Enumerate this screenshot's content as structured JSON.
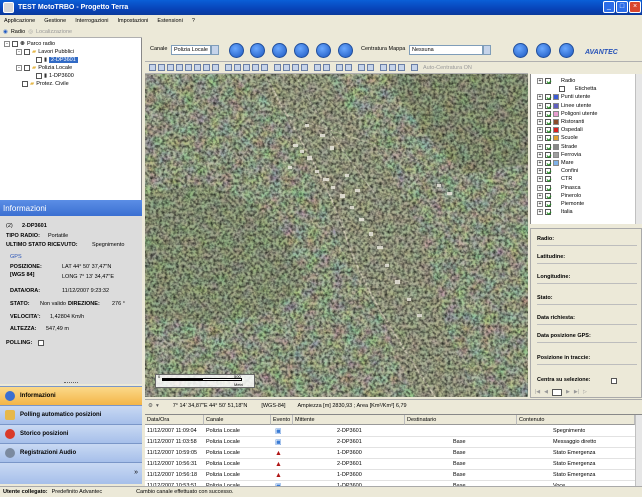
{
  "window": {
    "title": "TEST MotoTRBO - Progetto Terra"
  },
  "menu": [
    "Applicazione",
    "Gestione",
    "Interrogazioni",
    "Impostazioni",
    "Estensioni",
    "?"
  ],
  "left_toolbar": {
    "tab1": "Radio",
    "tab2": "Localizzazione"
  },
  "tree": {
    "root": "Parco radio",
    "groups": [
      {
        "label": "Lavori Pubblici",
        "children": [
          "2-DP3601"
        ]
      },
      {
        "label": "Polizia Locale",
        "children": [
          "1-DP3600"
        ]
      },
      {
        "label": "Protez. Civile",
        "children": []
      }
    ]
  },
  "info": {
    "header": "Informazioni",
    "id_prefix": "(2)",
    "radio_name": "2-DP3601",
    "tipo_label": "TIPO RADIO:",
    "tipo_value": "Portatile",
    "stato_ric_label": "ULTIMO STATO RICEVUTO:",
    "stato_ric_value": "Spegnimento",
    "gps_label": "GPS",
    "pos_label": "POSIZIONE:",
    "wgs_label": "[WGS 84]",
    "lat": "LAT 44° 50' 37,47\"N",
    "long": "LONG 7° 13' 34,47\"E",
    "dataora_label": "DATA/ORA:",
    "dataora_value": "11/12/2007 9:23:32",
    "stato_label": "STATO:",
    "stato_value": "Non valido",
    "dir_label": "DIREZIONE:",
    "dir_value": "276 °",
    "vel_label": "VELOCITA':",
    "vel_value": "1,42804 Km/h",
    "alt_label": "ALTEZZA:",
    "alt_value": "547,49 m",
    "polling_label": "POLLING:"
  },
  "nav": [
    "Informazioni",
    "Polling automatico posizioni",
    "Storico posizioni",
    "Registrazioni Audio"
  ],
  "map_toolbar": {
    "canale_label": "Canale",
    "canale_value": "Polizia Locale",
    "centratura_label": "Centratura Mappa",
    "centratura_value": "Nessuna",
    "auto_label": "Auto-Centratura ON",
    "brand": "AVANTEC"
  },
  "scale": {
    "zero": "0",
    "end": "500",
    "unit": "Metri"
  },
  "coords": {
    "position": "7° 14' 34,87\"E  44° 50' 51,18\"N",
    "crs": "[WGS-84]",
    "ampiezza": "Ampiezza [m] 2830,93 ; Area [Km²/Km²] 6,79"
  },
  "layers": [
    {
      "label": "Radio",
      "checked": true,
      "color": ""
    },
    {
      "label": "Etichetta",
      "checked": false,
      "color": ""
    },
    {
      "label": "Punti utente",
      "checked": true,
      "color": "#3b5bd6"
    },
    {
      "label": "Linee utente",
      "checked": true,
      "color": "#6060c0"
    },
    {
      "label": "Poligoni utente",
      "checked": true,
      "color": "#e89fd0"
    },
    {
      "label": "Ristoranti",
      "checked": true,
      "color": "#8b4b2b"
    },
    {
      "label": "Ospedali",
      "checked": true,
      "color": "#d92020"
    },
    {
      "label": "Scuole",
      "checked": true,
      "color": "#e0a030"
    },
    {
      "label": "Strade",
      "checked": true,
      "color": "#888888"
    },
    {
      "label": "Ferrovia",
      "checked": true,
      "color": "#a0a0a0"
    },
    {
      "label": "Mare",
      "checked": true,
      "color": "#7fb2e8"
    },
    {
      "label": "Confini",
      "checked": true,
      "color": ""
    },
    {
      "label": "CTR",
      "checked": true,
      "color": ""
    },
    {
      "label": "Pinasca",
      "checked": true,
      "color": ""
    },
    {
      "label": "Pinerolo",
      "checked": true,
      "color": ""
    },
    {
      "label": "Piemonte",
      "checked": true,
      "color": ""
    },
    {
      "label": "Italia",
      "checked": true,
      "color": ""
    }
  ],
  "details": {
    "radio": "Radio:",
    "lat": "Latitudine:",
    "long": "Longitudine:",
    "stato": "Stato:",
    "data_rich": "Data richiesta:",
    "data_gps": "Data posizione GPS:",
    "pos_tracce": "Posizione in traccie:",
    "centra": "Centra su selezione:"
  },
  "grid": {
    "headers": [
      "Data/Ora",
      "Canale",
      "Evento",
      "Mittente",
      "Destinatario",
      "Contenuto"
    ],
    "rows": [
      {
        "date": "11/12/2007 11:09:04",
        "canale": "Polizia Locale",
        "event": "gps",
        "mittente": "2-DP3601",
        "dest": "",
        "content": "Spegnimento"
      },
      {
        "date": "11/12/2007 11:03:58",
        "canale": "Polizia Locale",
        "event": "gps",
        "mittente": "2-DP3601",
        "dest": "Base",
        "content": "Messaggio diretto"
      },
      {
        "date": "11/12/2007 10:59:05",
        "canale": "Polizia Locale",
        "event": "alarm",
        "mittente": "1-DP3600",
        "dest": "Base",
        "content": "Stato Emergenza"
      },
      {
        "date": "11/12/2007 10:56:31",
        "canale": "Polizia Locale",
        "event": "alarm",
        "mittente": "2-DP3601",
        "dest": "Base",
        "content": "Stato Emergenza"
      },
      {
        "date": "11/12/2007 10:56:18",
        "canale": "Polizia Locale",
        "event": "alarm",
        "mittente": "1-DP3600",
        "dest": "Base",
        "content": "Stato Emergenza"
      },
      {
        "date": "11/12/2007 10:53:51",
        "canale": "Polizia Locale",
        "event": "gps",
        "mittente": "1-DP3600",
        "dest": "Base",
        "content": "Voce"
      }
    ]
  },
  "status": {
    "user": "Utente collegato:",
    "user_value": "Predefinito Advantec",
    "message": "Cambio canale effettuato con successo."
  }
}
